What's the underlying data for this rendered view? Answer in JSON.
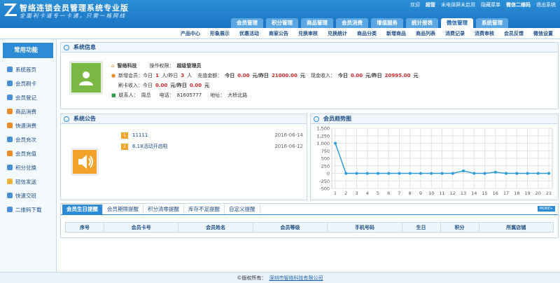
{
  "brand": {
    "title": "智络连锁会员管理系统专业版",
    "slogan": "全面利卡道专一卡通，只需一格网线"
  },
  "toplinks": {
    "welcome": "欢迎",
    "user": "超管",
    "notice": "未电弹屏未启用",
    "hide_menu": "隐藏菜单",
    "qrcode": "微信二维码",
    "logout": "退出系统"
  },
  "main_tabs": [
    "会员管理",
    "积分管理",
    "商品管理",
    "会员消费",
    "增值服务",
    "统计报表",
    "微信管理",
    "系统管理"
  ],
  "active_tab": "微信管理",
  "sub_nav": [
    "产品中心",
    "形象展示",
    "优惠活动",
    "商家公告",
    "兑换审核",
    "兑换统计",
    "商品分类",
    "新增商品",
    "商品列表",
    "消费记录",
    "消费审核",
    "会员反馈",
    "微信设置"
  ],
  "sidebar": {
    "title": "常用功能",
    "items": [
      {
        "label": "系统首页",
        "color": "#4a90d9"
      },
      {
        "label": "会员刷卡",
        "color": "#4a90d9"
      },
      {
        "label": "会员登记",
        "color": "#4a90d9"
      },
      {
        "label": "商品消费",
        "color": "#e98b2a"
      },
      {
        "label": "快速消费",
        "color": "#e98b2a"
      },
      {
        "label": "会员充次",
        "color": "#4a90d9"
      },
      {
        "label": "会员充值",
        "color": "#e98b2a"
      },
      {
        "label": "积分兑换",
        "color": "#4a90d9"
      },
      {
        "label": "短信发送",
        "color": "#f0b43b"
      },
      {
        "label": "快速交班",
        "color": "#4a90d9"
      },
      {
        "label": "二维码下载",
        "color": "#4a90d9"
      }
    ]
  },
  "sysinfo": {
    "title": "系统信息",
    "company": "智络科技",
    "perm_label": "操作权限：",
    "perm": "超级管理员",
    "new_members_label": "新增会员：今日",
    "new_today": "1",
    "new_mid": "人/昨日",
    "new_yest": "3",
    "new_unit": "人",
    "recharge_label": "充值金额：",
    "recharge_today_label": "今日",
    "recharge_today": "0.00",
    "recharge_mid": "元/昨日",
    "recharge_yest": "21000.00",
    "recharge_unit": "元",
    "cash_label": "现金收入：",
    "cash_today_label": "今日",
    "cash_today": "0.00",
    "cash_mid": "元/昨日",
    "cash_yest": "20995.00",
    "cash_unit": "元",
    "swipe_label": "刷卡收入：今日",
    "swipe_today": "0.00",
    "swipe_mid": "元/昨日",
    "swipe_yest": "0.00",
    "swipe_unit": "元",
    "contact_label": "联系人：",
    "contact": "周总",
    "phone_label": "电话：",
    "phone": "81605777",
    "addr_label": "地址：",
    "addr": "大桥北路"
  },
  "notices": {
    "title": "系统公告",
    "items": [
      {
        "num": "1",
        "text": "11111",
        "date": "2016-06-14"
      },
      {
        "num": "2",
        "text": "6.18活动开启啦",
        "date": "2016-06-12"
      }
    ]
  },
  "trend": {
    "title": "会员趋势图"
  },
  "chart_data": {
    "type": "line",
    "x": [
      1,
      2,
      3,
      4,
      5,
      6,
      7,
      8,
      9,
      10,
      11,
      12,
      13,
      14,
      15,
      16,
      17,
      18,
      19,
      20,
      21
    ],
    "values": [
      1000,
      0,
      0,
      0,
      0,
      0,
      0,
      0,
      0,
      0,
      0,
      0,
      80,
      0,
      0,
      40,
      0,
      0,
      0,
      0,
      0
    ],
    "ylim": [
      -500,
      1500
    ],
    "yticks": [
      "1,500",
      "1,250",
      "1,000",
      "750",
      "500",
      "250",
      "0",
      "-250",
      "-500"
    ],
    "line_color": "#2e9bd6",
    "grid": true
  },
  "reminders": {
    "tabs": [
      "会员生日提醒",
      "会员期限提醒",
      "积分清零提醒",
      "库存不足提醒",
      "自定义提醒"
    ],
    "more": "MORE+",
    "columns": [
      "序号",
      "会员卡号",
      "会员姓名",
      "会员等级",
      "手机号码",
      "生日",
      "积分",
      "所属店铺"
    ]
  },
  "footer": {
    "copyright": "©版权所有：",
    "company": "深圳市智络科技有限公司"
  }
}
